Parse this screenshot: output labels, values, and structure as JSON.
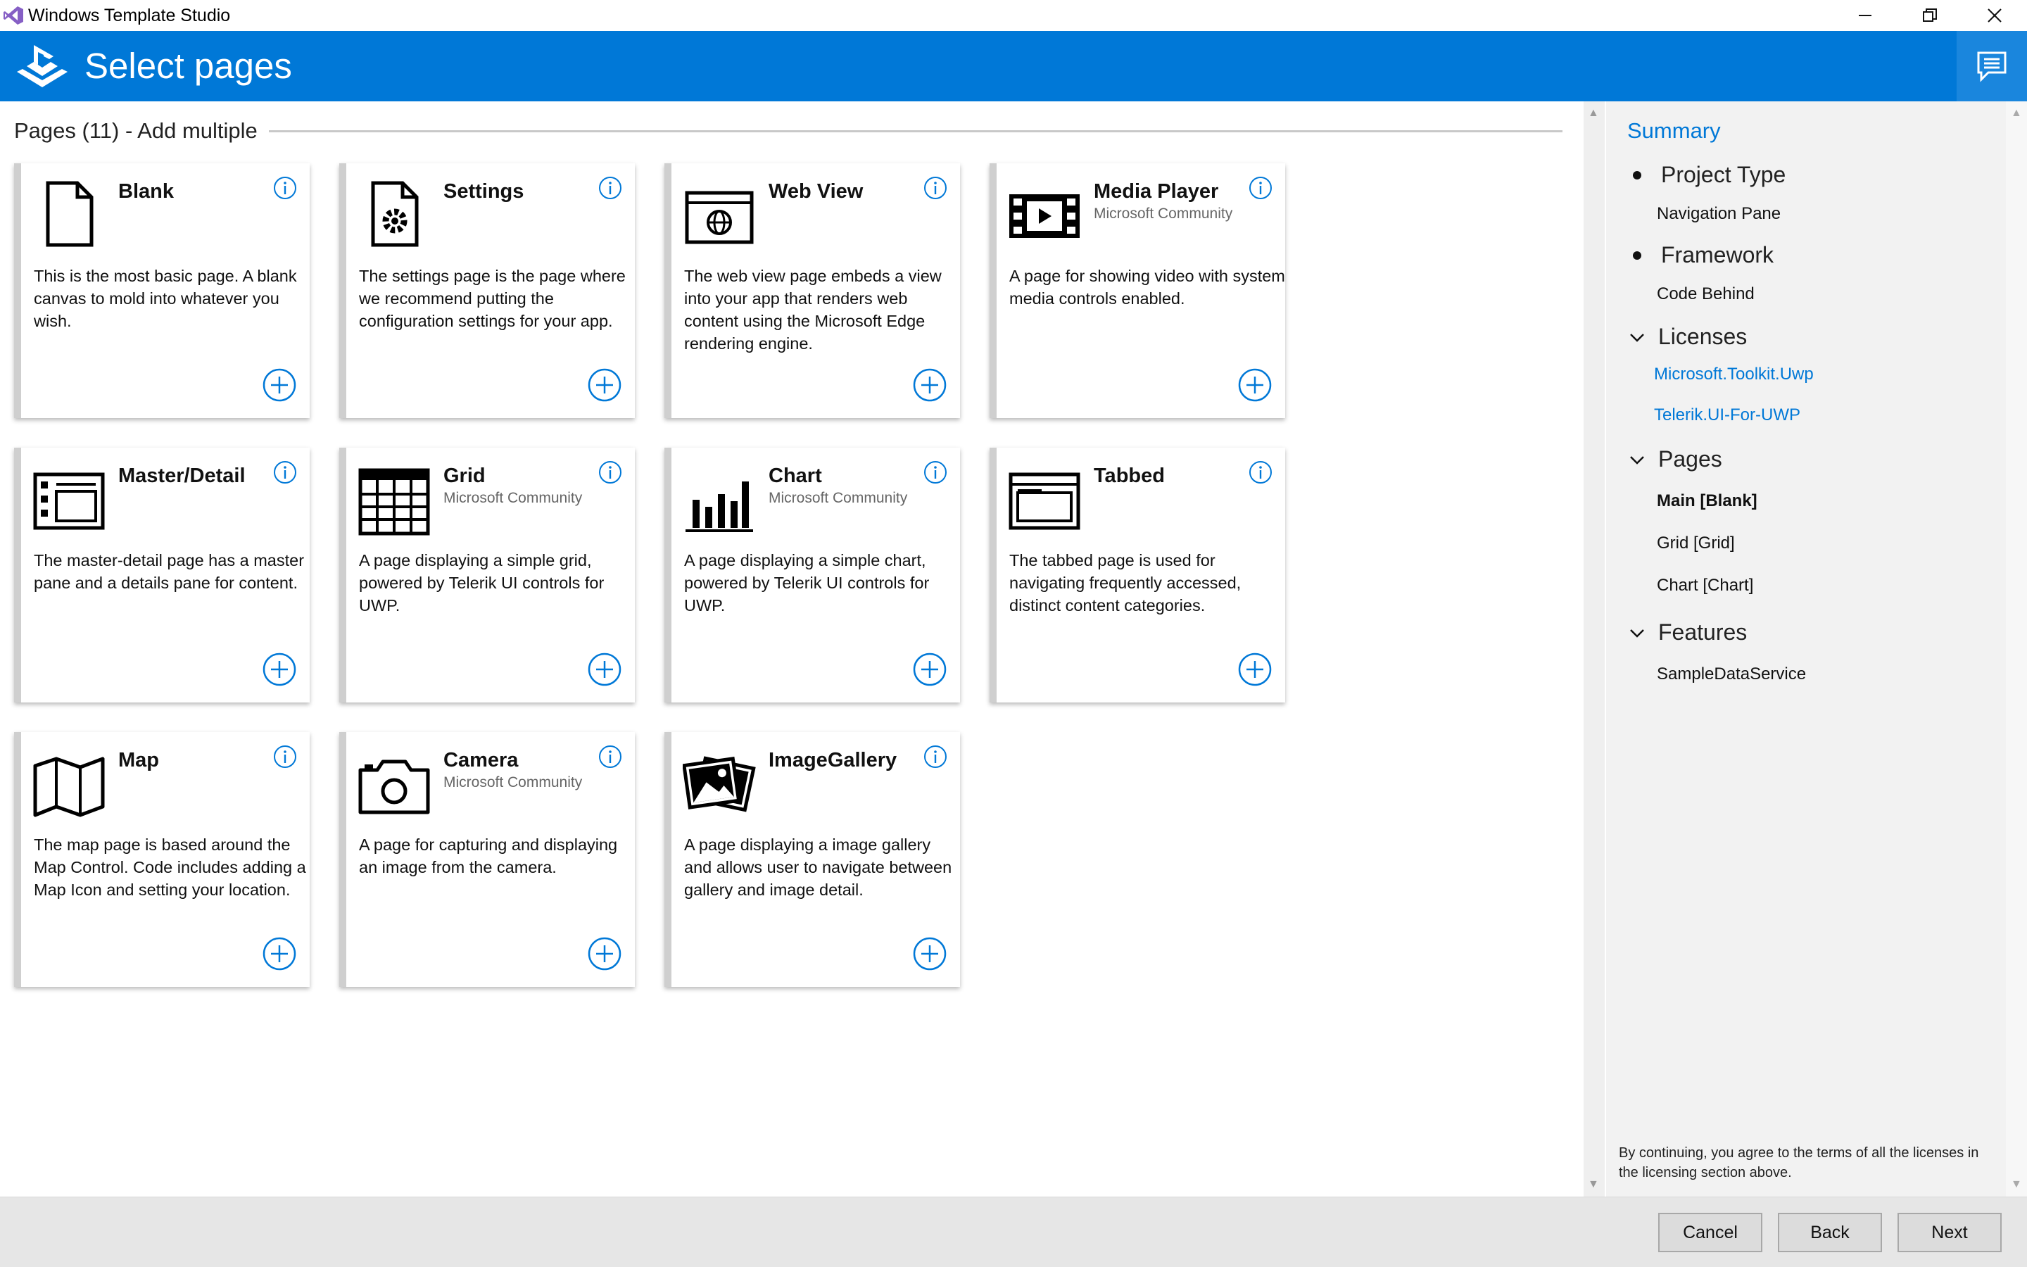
{
  "window": {
    "title": "Windows Template Studio",
    "controls": [
      "minimize-icon",
      "restore-icon",
      "close-icon"
    ]
  },
  "header": {
    "title": "Select pages",
    "accent_color": "#0078d7"
  },
  "main": {
    "section_label": "Pages (11) - Add multiple",
    "cards": [
      {
        "title": "Blank",
        "subtitle": "",
        "icon": "blank-page-icon",
        "description": "This is the most basic page. A blank canvas to mold into whatever you wish."
      },
      {
        "title": "Settings",
        "subtitle": "",
        "icon": "settings-page-icon",
        "description": "The settings page is the page where we recommend putting the configuration settings for your app."
      },
      {
        "title": "Web View",
        "subtitle": "",
        "icon": "web-view-icon",
        "description": "The web view page embeds a view into your app that renders web content using the Microsoft Edge rendering engine."
      },
      {
        "title": "Media Player",
        "subtitle": "Microsoft Community",
        "icon": "film-strip-icon",
        "description": "A page for showing video with system media controls enabled."
      },
      {
        "title": "Master/Detail",
        "subtitle": "",
        "icon": "master-detail-icon",
        "description": "The master-detail page has a master pane and a details pane for content."
      },
      {
        "title": "Grid",
        "subtitle": "Microsoft Community",
        "icon": "grid-table-icon",
        "description": "A page displaying a simple grid, powered by Telerik UI controls for UWP."
      },
      {
        "title": "Chart",
        "subtitle": "Microsoft Community",
        "icon": "bar-chart-icon",
        "description": "A page displaying a simple chart, powered by Telerik UI controls for UWP."
      },
      {
        "title": "Tabbed",
        "subtitle": "",
        "icon": "tabbed-window-icon",
        "description": "The tabbed page is used for navigating frequently accessed, distinct content categories."
      },
      {
        "title": "Map",
        "subtitle": "",
        "icon": "folded-map-icon",
        "description": "The map page is based around the Map Control. Code includes adding a Map Icon and setting your location."
      },
      {
        "title": "Camera",
        "subtitle": "Microsoft Community",
        "icon": "camera-icon",
        "description": "A page for capturing and displaying an image from the camera."
      },
      {
        "title": "ImageGallery",
        "subtitle": "",
        "icon": "photo-stack-icon",
        "description": "A page displaying a image gallery and allows user to navigate between gallery and image detail."
      }
    ]
  },
  "summary": {
    "title": "Summary",
    "project_type_label": "Project Type",
    "project_type_value": "Navigation Pane",
    "framework_label": "Framework",
    "framework_value": "Code Behind",
    "licenses_label": "Licenses",
    "licenses": [
      "Microsoft.Toolkit.Uwp",
      "Telerik.UI-For-UWP"
    ],
    "pages_label": "Pages",
    "pages": [
      "Main [Blank]",
      "Grid [Grid]",
      "Chart [Chart]"
    ],
    "features_label": "Features",
    "features": [
      "SampleDataService"
    ],
    "legal_text": "By continuing, you agree to the terms of all the licenses in the licensing section above."
  },
  "footer": {
    "cancel_label": "Cancel",
    "back_label": "Back",
    "next_label": "Next"
  }
}
